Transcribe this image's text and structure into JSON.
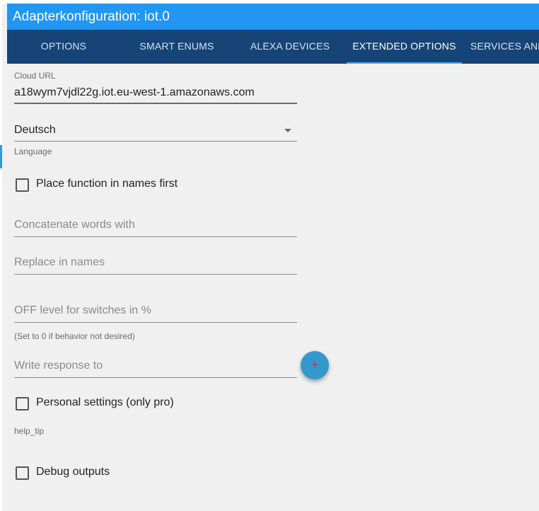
{
  "window": {
    "title": "Adapterkonfiguration: iot.0"
  },
  "tabs": [
    {
      "label": "OPTIONS",
      "active": false
    },
    {
      "label": "SMART ENUMS",
      "active": false
    },
    {
      "label": "ALEXA DEVICES",
      "active": false
    },
    {
      "label": "EXTENDED OPTIONS",
      "active": true
    },
    {
      "label": "SERVICES AND",
      "active": false
    }
  ],
  "form": {
    "cloud_url": {
      "label": "Cloud URL",
      "value": "a18wym7vjdl22g.iot.eu-west-1.amazonaws.com"
    },
    "language": {
      "value": "Deutsch",
      "helper": "Language"
    },
    "place_function_first": {
      "label": "Place function in names first",
      "checked": false
    },
    "concatenate_words": {
      "placeholder": "Concatenate words with"
    },
    "replace_in_names": {
      "placeholder": "Replace in names"
    },
    "off_level": {
      "placeholder": "OFF level for switches in %",
      "helper": "(Set to 0 if behavior not desired)"
    },
    "write_response": {
      "placeholder": "Write response to",
      "add_button_symbol": "+"
    },
    "personal_settings": {
      "label": "Personal settings (only pro)",
      "checked": false,
      "helper": "help_tip"
    },
    "debug_outputs": {
      "label": "Debug outputs",
      "checked": false
    }
  },
  "colors": {
    "titlebar": "#2196f3",
    "tabbar": "#164477",
    "tab_indicator": "#3fa9f5",
    "background": "#f0f0f0",
    "fab": "#3399cc"
  }
}
